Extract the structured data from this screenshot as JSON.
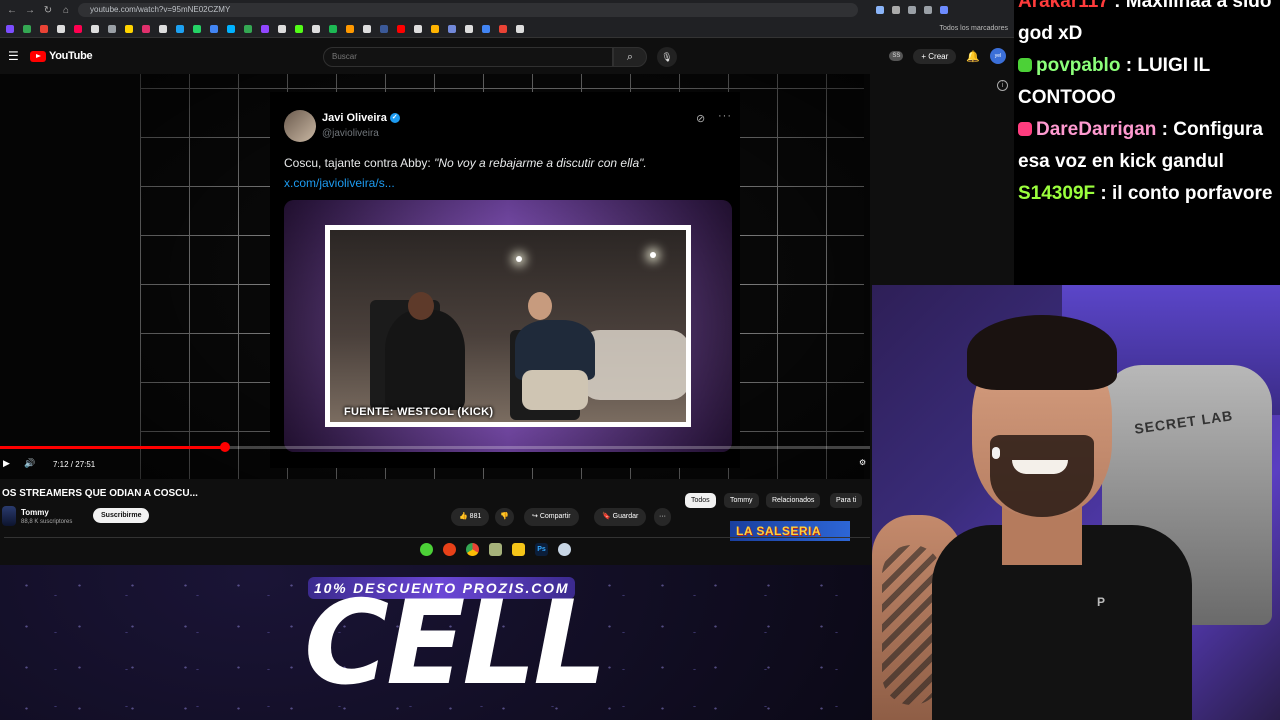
{
  "browser": {
    "url": "youtube.com/watch?v=95mNE02CZMY",
    "bookmarks_label": "Todos los marcadores"
  },
  "youtube": {
    "logo_text": "YouTube",
    "search_placeholder": "Buscar",
    "account_badge": "SS",
    "create_label": "Crear",
    "avatar_text": "yel"
  },
  "tweet": {
    "author": "Javi Oliveira",
    "handle": "@javioliveira",
    "text_plain": "Coscu, tajante contra Abby: ",
    "text_quote": "\"No voy a rebajarme a discutir con ella\".",
    "link": "x.com/javioliveira/s...",
    "image_caption": "FUENTE: WESTCOL (KICK)"
  },
  "player": {
    "time": "7:12 / 27:51",
    "progress_fraction": 0.2585
  },
  "video": {
    "title": "OS STREAMERS QUE ODIAN A COSCU...",
    "channel": "Tommy",
    "subscribers": "88,8 K suscriptores",
    "subscribe_label": "Suscribirme",
    "likes": "881",
    "share_label": "Compartir",
    "save_label": "Guardar"
  },
  "chips": [
    "Todos",
    "Tommy",
    "Relacionados",
    "Para ti"
  ],
  "next_thumb_text": "LA SALSERIA",
  "promo": {
    "banner": "10% DESCUENTO PROZIS.COM",
    "headline": "CELL"
  },
  "chat": [
    {
      "user": "Arakar117",
      "sep": " : ",
      "text": "Maxiiinaa a sido god xD",
      "color": "#ff3b3b",
      "badge": ""
    },
    {
      "user": "povpablo",
      "sep": " : ",
      "text": "LUIGI IL CONTOOO",
      "color": "#8cff7a",
      "badge": "#4cd137"
    },
    {
      "user": "DareDarrigan",
      "sep": " : ",
      "text": "Configura esa voz en kick gandul",
      "color": "#ff9ad0",
      "badge": "#ff3d7f"
    },
    {
      "user": "S14309F",
      "sep": " : ",
      "text": "il conto porfavore",
      "color": "#9bff3d",
      "badge": ""
    }
  ],
  "webcam": {
    "chair_brand": "SECRET LAB",
    "shirt_logo": "P"
  },
  "colors": {
    "youtube_red": "#ff0000",
    "link_blue": "#1d9bf0",
    "promo_purple": "#6b47d6"
  }
}
